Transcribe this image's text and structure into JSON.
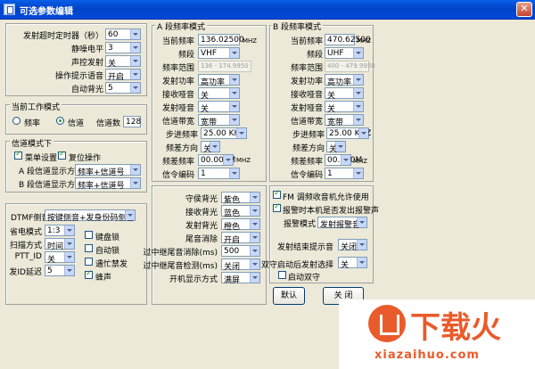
{
  "window": {
    "title": "可选参数编辑",
    "close": "✕"
  },
  "general": [
    {
      "label": "发射超时定时器（秒）",
      "value": "60"
    },
    {
      "label": "静噪电平",
      "value": "3"
    },
    {
      "label": "声控发射",
      "value": "关"
    },
    {
      "label": "操作提示语音",
      "value": "开启"
    },
    {
      "label": "自动背光",
      "value": "5"
    }
  ],
  "mode": {
    "group": "当前工作模式",
    "freq": "频率",
    "channel": "信道",
    "channel_count_label": "信道数",
    "channel_count": "128",
    "selected": "channel"
  },
  "channel_mode": {
    "group": "信道模式下",
    "menu_settings": "菜单设置",
    "reset_op": "复位操作",
    "a_label": "A 段信道显示方式",
    "a_value": "频率+信道号",
    "b_label": "B 段信道显示方式",
    "b_value": "频率+信道号"
  },
  "ab_labels": [
    "当前频率",
    "频段",
    "频率范围",
    "发射功率",
    "接收哑音",
    "发射哑音",
    "信道带宽",
    "步进频率",
    "频差方向",
    "频差频率",
    "信令编码"
  ],
  "band_a": {
    "title": "A 段频率模式",
    "freq": "136.02500",
    "unit": "MHZ",
    "band": "VHF",
    "range": "136 - 174.9950",
    "power": "高功率",
    "rx_mute": "关",
    "tx_mute": "关",
    "bandwidth": "宽带",
    "step": "25.00 KHZ",
    "offset_dir": "关",
    "offset_freq": "00.000M",
    "offset_unit": "MHZ",
    "signal": "1"
  },
  "band_b": {
    "title": "B 段频率模式",
    "freq": "470.62500",
    "unit": "MHZ",
    "band": "UHF",
    "range": "400 - 479.9950",
    "power": "高功率",
    "rx_mute": "关",
    "tx_mute": "关",
    "bandwidth": "宽带",
    "step": "25.00 KHZ",
    "offset_dir": "关",
    "offset_freq": "00.000M",
    "offset_unit": "MHZ",
    "signal": "1"
  },
  "backlight": [
    {
      "label": "守侯背光",
      "value": "紫色"
    },
    {
      "label": "接收背光",
      "value": "蓝色"
    },
    {
      "label": "发射背光",
      "value": "橙色"
    },
    {
      "label": "尾音消除",
      "value": "开启"
    },
    {
      "label": "过中继尾音消除(ms)",
      "value": "500"
    },
    {
      "label": "过中继尾音检测(ms)",
      "value": "关闭"
    },
    {
      "label": "开机显示方式",
      "value": "满屏"
    }
  ],
  "fm": {
    "fm_allow": "FM 调频收音机允许使用",
    "alarm_local": "报警时本机是否发出报警声",
    "alarm_mode_label": "报警模式",
    "alarm_mode": "发射报警音",
    "tx_end_label": "发射结束提示音",
    "tx_end": "关闭",
    "dual_label": "双守启动后发射选择",
    "dual": "关",
    "dual_start": "启动双守"
  },
  "dtmf": {
    "sidetone_label": "DTMF侧音",
    "sidetone": "按键侧音+发身份码侧音",
    "save_label": "省电模式",
    "save": "1:3",
    "scan_label": "扫描方式",
    "scan": "时间",
    "ptt_label": "PTT_ID",
    "ptt": "关",
    "sendid_label": "发ID延迟",
    "sendid": "5",
    "keylock": "键盘锁",
    "autolock": "自动锁",
    "busy": "遇忙禁发",
    "beep": "蜂声"
  },
  "buttons": {
    "default": "默认",
    "close": "关 闭"
  },
  "watermark": {
    "brand": "下载火",
    "url": "xiazaihuo.com"
  }
}
